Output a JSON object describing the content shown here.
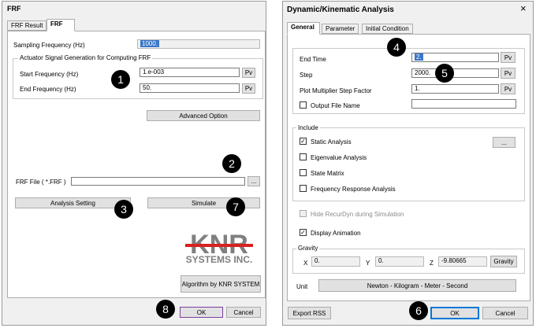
{
  "frf": {
    "title": "FRF",
    "tabs": [
      "FRF Result",
      "FRF"
    ],
    "sampling_label": "Sampling Frequency (Hz)",
    "sampling_value": "1000.",
    "group_title": "Actuator Signal Generation for Computing FRF",
    "start_label": "Start Frequency (Hz)",
    "start_value": "1.e-003",
    "end_label": "End Frequency (Hz)",
    "end_value": "50.",
    "pv": "Pv",
    "advanced": "Advanced Option",
    "frf_file_label": "FRF File ( *.FRF )",
    "frf_file_value": "",
    "browse": "...",
    "analysis_setting": "Analysis Setting",
    "simulate": "Simulate",
    "logo_main": "KNR",
    "logo_sub": "SYSTEMS INC.",
    "algorithm": "Algorithm by KNR SYSTEM",
    "ok": "OK",
    "cancel": "Cancel"
  },
  "dka": {
    "title": "Dynamic/Kinematic Analysis",
    "close": "×",
    "tabs": [
      "General",
      "Parameter",
      "Initial Condition"
    ],
    "end_time_label": "End Time",
    "end_time_value": "2.",
    "step_label": "Step",
    "step_value": "2000.",
    "plot_label": "Plot Multiplier Step Factor",
    "plot_value": "1.",
    "output_label": "Output File Name",
    "output_value": "",
    "pv": "Pv",
    "include_title": "Include",
    "static": "Static Analysis",
    "static_btn": "...",
    "eigen": "Eigenvalue Analysis",
    "state": "State Matrix",
    "freq": "Frequency Response Analysis",
    "hide": "Hide RecurDyn during Simulation",
    "display": "Display Animation",
    "gravity_title": "Gravity",
    "gx_label": "X",
    "gx_value": "0.",
    "gy_label": "Y",
    "gy_value": "0.",
    "gz_label": "Z",
    "gz_value": "-9.80665",
    "gravity_btn": "Gravity",
    "unit_label": "Unit",
    "unit_value": "Newton - Kilogram - Meter - Second",
    "export": "Export RSS",
    "ok": "OK",
    "cancel": "Cancel"
  },
  "callouts": [
    "1",
    "2",
    "3",
    "4",
    "5",
    "6",
    "7",
    "8"
  ],
  "colors": {
    "accent": "#0078d7",
    "selection": "#3a77c8",
    "logo_gray": "#7f7f7f",
    "logo_red": "#d8221e"
  }
}
